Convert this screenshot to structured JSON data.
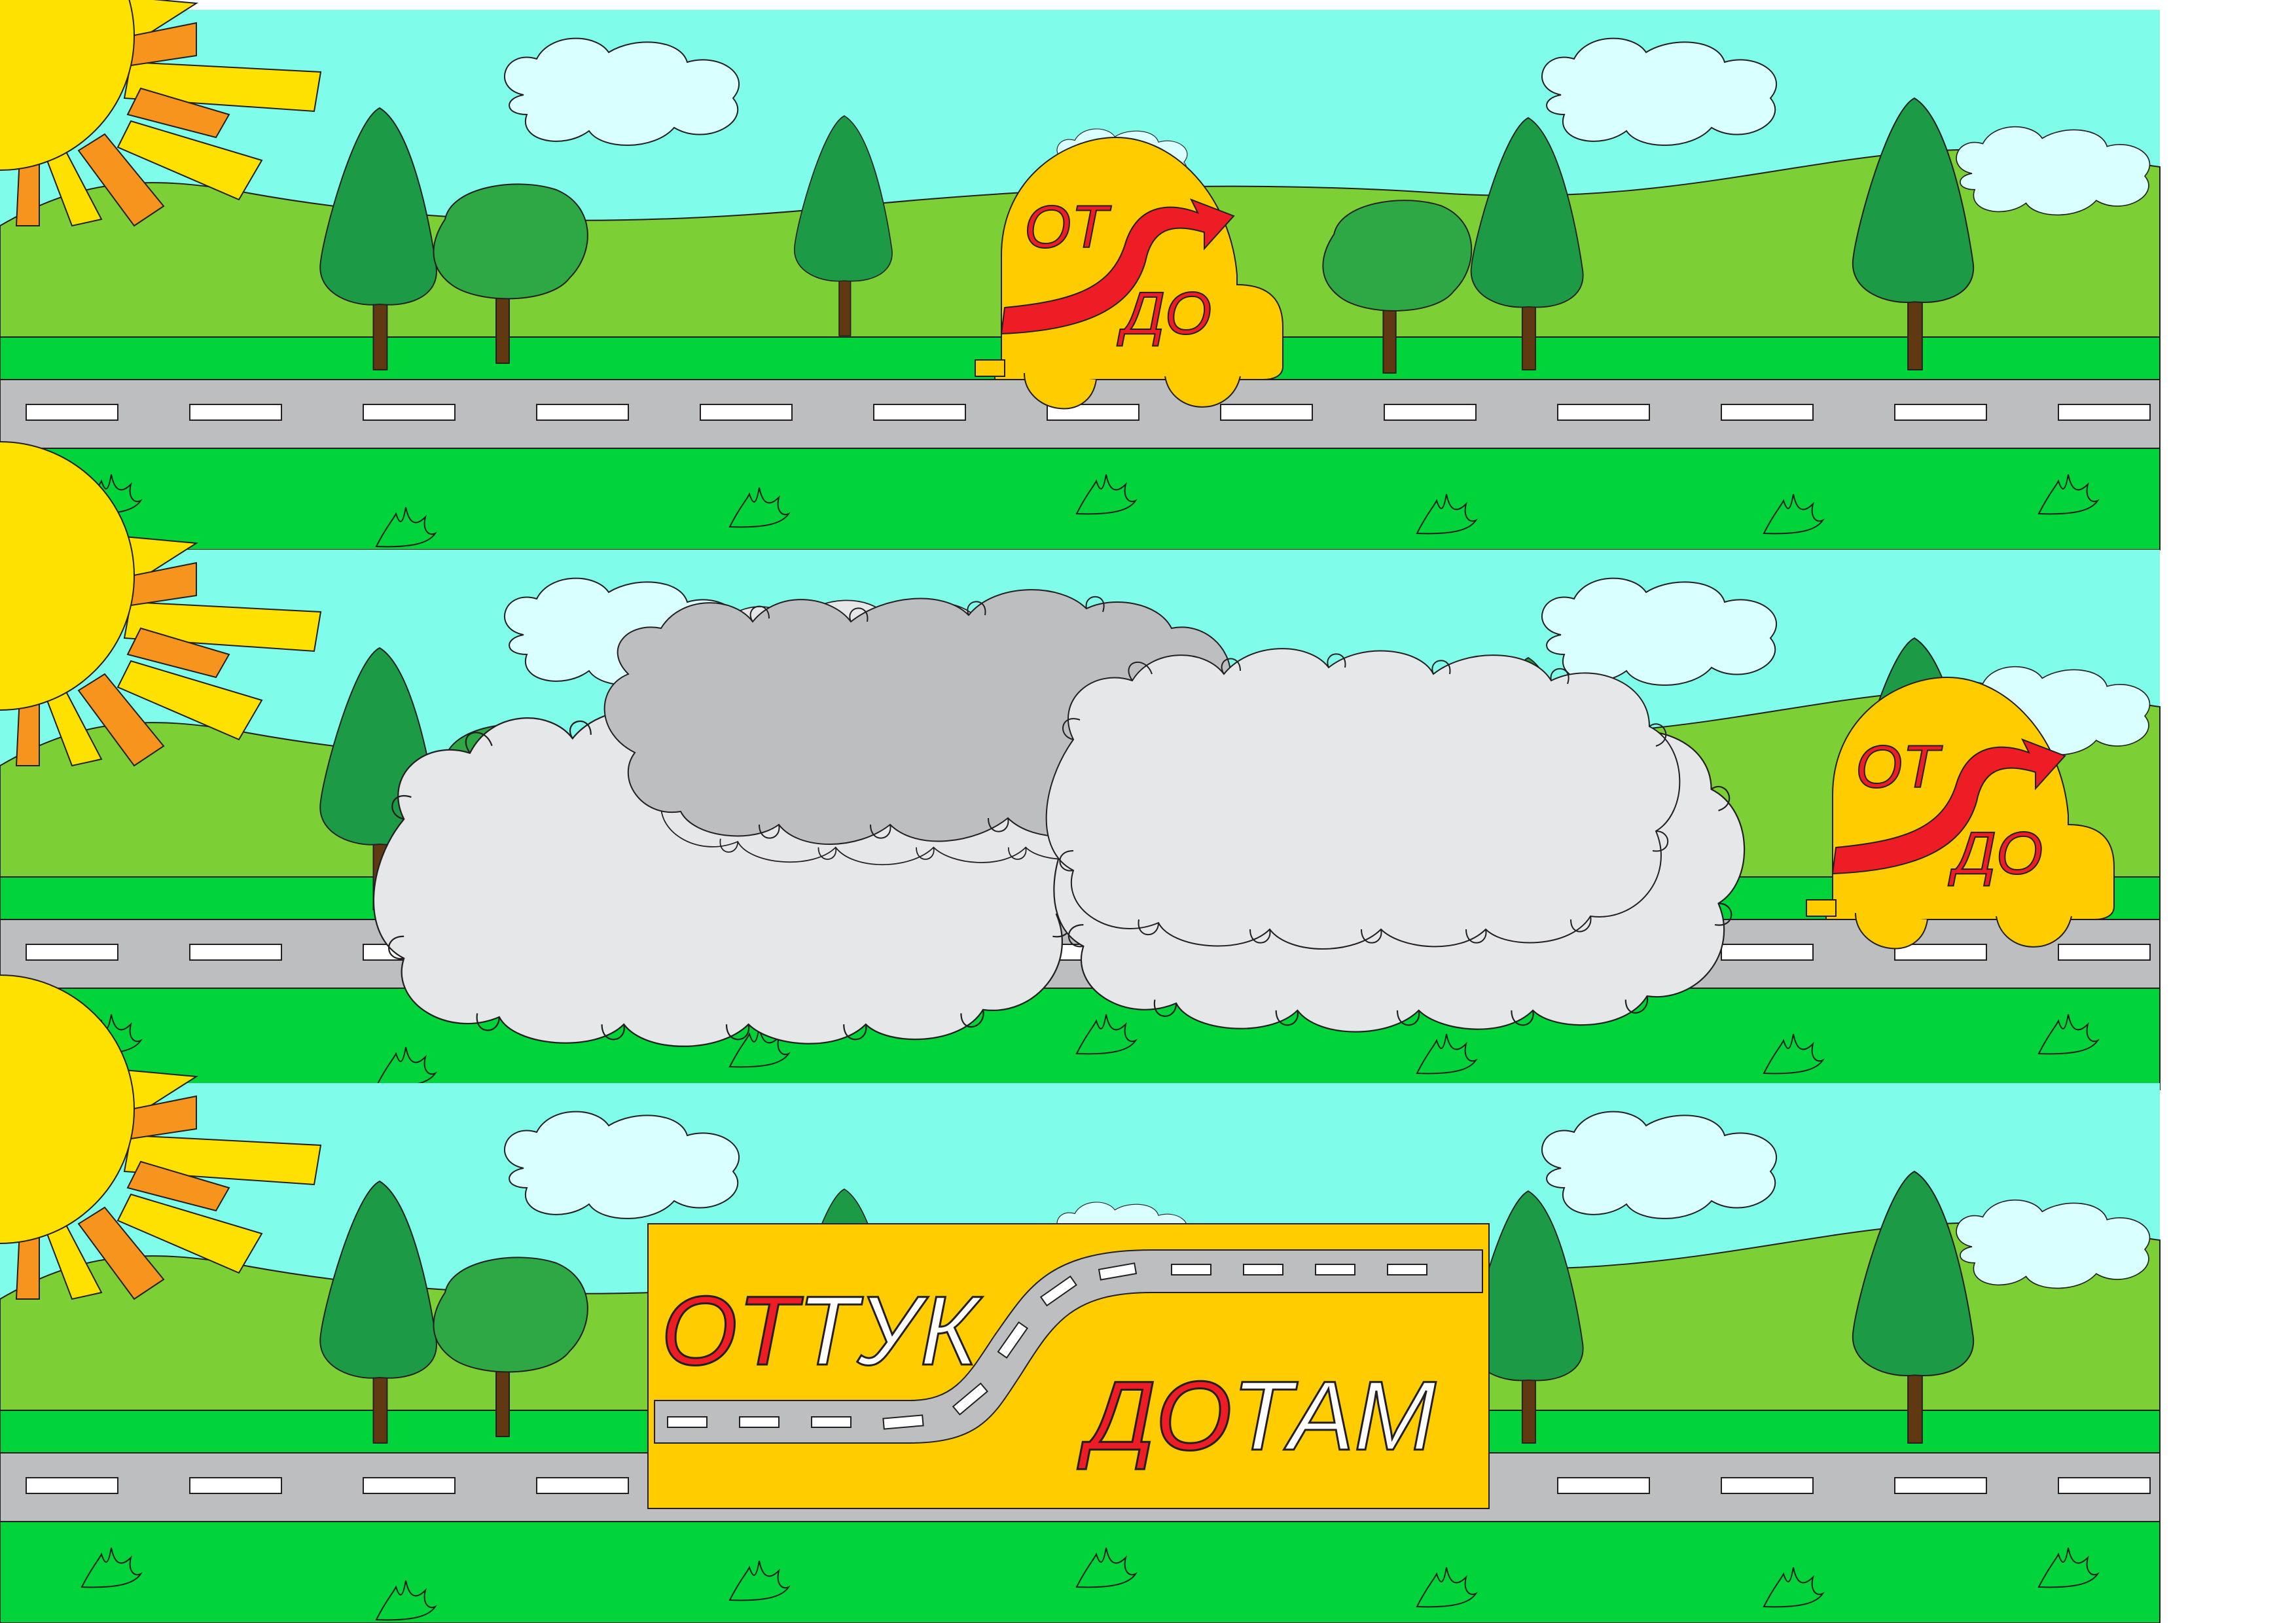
{
  "car_logo": {
    "from": "ОТ",
    "to": "ДО"
  },
  "sign": {
    "from_word": {
      "red": "ОТ",
      "rest": "ТУК"
    },
    "to_word": {
      "red": "ДО",
      "rest": "ТАМ"
    }
  },
  "colors": {
    "sky": "#7ffdea",
    "grass": "#00d43a",
    "hills": "#7ccf35",
    "road": "#bcbec0",
    "car": "#ffcc00",
    "arrow": "#ee1c25",
    "smoke": "#e6e7e8",
    "smoke_dark": "#bcbec0",
    "sun": "#ffe100",
    "sun_ray": "#f7941d"
  },
  "panels": [
    {
      "id": "car-scene",
      "elements": [
        "sun-icon",
        "clouds",
        "trees",
        "road",
        "car-icon"
      ]
    },
    {
      "id": "smoke-scene",
      "elements": [
        "sun-icon",
        "smoke-cloud-icon",
        "car-icon"
      ]
    },
    {
      "id": "sign-scene",
      "elements": [
        "sun-icon",
        "trees",
        "road",
        "sign-logo"
      ]
    }
  ]
}
